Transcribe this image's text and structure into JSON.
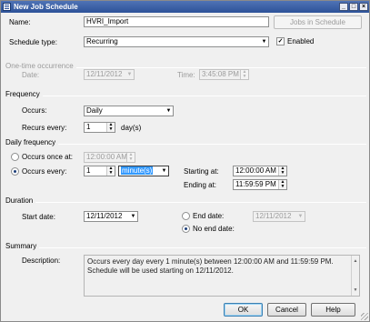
{
  "window": {
    "title": "New Job Schedule"
  },
  "name": {
    "label": "Name:",
    "value": "HVRI_Import",
    "jobs_button": "Jobs in Schedule"
  },
  "schedule_type": {
    "label": "Schedule type:",
    "value": "Recurring",
    "enabled_label": "Enabled",
    "enabled_checked": true
  },
  "one_time": {
    "section": "One-time occurrence",
    "date_label": "Date:",
    "date_value": "12/11/2012",
    "time_label": "Time:",
    "time_value": "3:45:08 PM"
  },
  "frequency": {
    "section": "Frequency",
    "occurs_label": "Occurs:",
    "occurs_value": "Daily",
    "recurs_label": "Recurs every:",
    "recurs_value": "1",
    "recurs_unit": "day(s)"
  },
  "daily_frequency": {
    "section": "Daily frequency",
    "once_label": "Occurs once at:",
    "once_value": "12:00:00 AM",
    "every_label": "Occurs every:",
    "every_value": "1",
    "every_unit": "minute(s)",
    "starting_label": "Starting at:",
    "starting_value": "12:00:00 AM",
    "ending_label": "Ending at:",
    "ending_value": "11:59:59 PM",
    "selected_option": "Occurs every"
  },
  "duration": {
    "section": "Duration",
    "start_label": "Start date:",
    "start_value": "12/11/2012",
    "end_label": "End date:",
    "end_value": "12/11/2012",
    "no_end_label": "No end date:",
    "selected_option": "No end date"
  },
  "summary": {
    "section": "Summary",
    "description_label": "Description:",
    "description_text": "Occurs every day every 1 minute(s) between 12:00:00 AM and 11:59:59 PM. Schedule will be used starting on 12/11/2012."
  },
  "buttons": {
    "ok": "OK",
    "cancel": "Cancel",
    "help": "Help"
  },
  "titlebar_buttons": {
    "minimize": "_",
    "maximize": "□",
    "close": "×"
  }
}
